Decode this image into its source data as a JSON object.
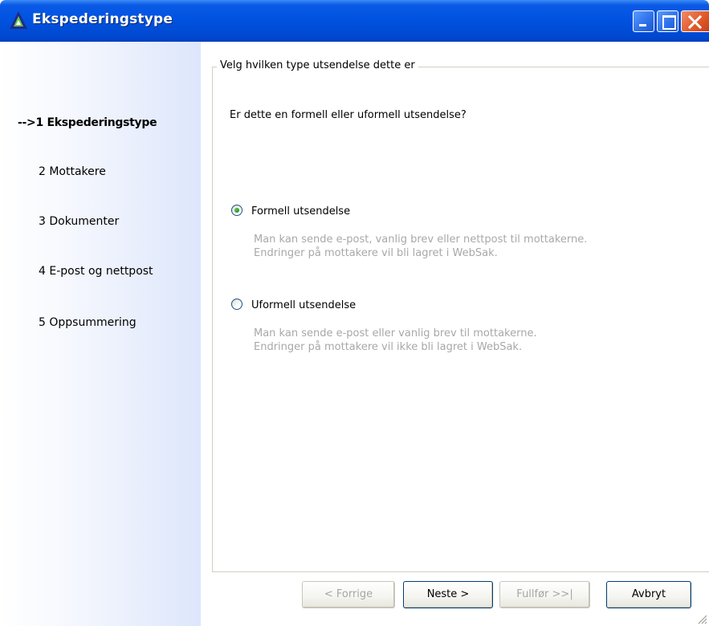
{
  "window": {
    "title": "Ekspederingstype",
    "controls": [
      "minimize-icon",
      "maximize-icon",
      "close-icon"
    ]
  },
  "sidebar": {
    "items": [
      {
        "label": "-->1 Ekspederingstype",
        "active": true
      },
      {
        "label": "2 Mottakere",
        "active": false
      },
      {
        "label": "3 Dokumenter",
        "active": false
      },
      {
        "label": "4 E-post og nettpost",
        "active": false
      },
      {
        "label": "5 Oppsummering",
        "active": false
      }
    ]
  },
  "main": {
    "group_title": "Velg hvilken type utsendelse dette er",
    "question": "Er dette en formell eller uformell utsendelse?",
    "options": [
      {
        "label": "Formell utsendelse",
        "checked": true,
        "desc_line1": "Man kan sende e-post, vanlig brev eller nettpost til mottakerne.",
        "desc_line2": "Endringer på mottakere vil bli lagret i WebSak."
      },
      {
        "label": "Uformell utsendelse",
        "checked": false,
        "desc_line1": "Man kan sende e-post eller vanlig brev til mottakerne.",
        "desc_line2": "Endringer på mottakere vil ikke bli lagret i WebSak."
      }
    ]
  },
  "buttons": {
    "back": "< Forrige",
    "next": "Neste >",
    "finish": "Fullfør >>|",
    "cancel": "Avbryt"
  },
  "colors": {
    "titlebar": "#0052de",
    "disabled_text": "#a8a8a8",
    "radio_dot": "#21a121"
  }
}
